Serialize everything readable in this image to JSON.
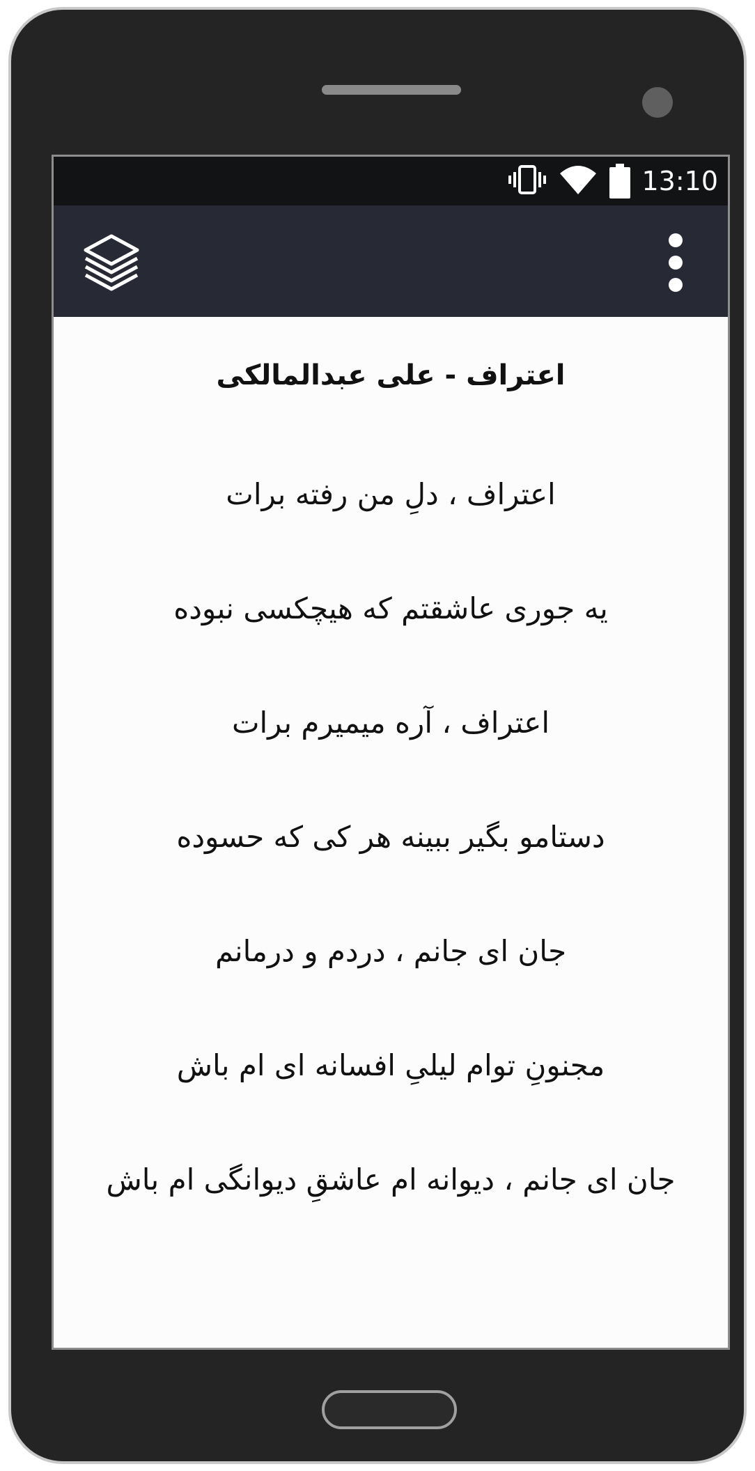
{
  "status_bar": {
    "time": "13:10",
    "icons": [
      "vibrate-icon",
      "wifi-icon",
      "battery-icon"
    ],
    "background": "#111315"
  },
  "app_bar": {
    "left_icon": "layers-icon",
    "right_icon": "overflow-menu-icon",
    "background": "#272a35"
  },
  "song": {
    "title": "اعتراف - علی عبدالمالکی",
    "lyrics": [
      "اعتراف ، دلِ من رفته برات",
      "یه جوری عاشقتم که هیچکسی نبوده",
      "اعتراف ، آره میمیرم برات",
      "دستامو بگیر ببینه هر کی که حسوده",
      "جان ای جانم ، دردم و درمانم",
      "مجنونِ توام لیلیِ افسانه ای ام باش",
      "جان ای جانم ، دیوانه ام عاشقِ دیوانگی ام باش"
    ]
  },
  "colors": {
    "screen_background": "#fcfcfc",
    "text": "#111111",
    "phone_body": "#242424"
  }
}
